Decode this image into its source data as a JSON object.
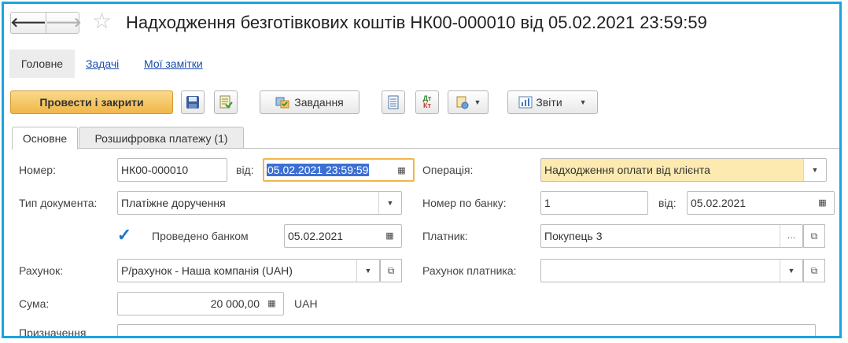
{
  "window": {
    "title": "Надходження безготівкових коштів НК00-000010 від 05.02.2021 23:59:59",
    "back_glyph": "🡐",
    "forward_glyph": "🡒",
    "favorite_glyph": "☆"
  },
  "panel_tabs": [
    {
      "label": "Головне"
    },
    {
      "label": "Задачі"
    },
    {
      "label": "Мої замітки"
    }
  ],
  "toolbar": {
    "post_and_close": "Провести і закрити",
    "tasks": "Завдання",
    "reports": "Звіти",
    "dtkt_top": "Дт",
    "dtkt_bottom": "Кт"
  },
  "form_tabs": [
    {
      "label": "Основне"
    },
    {
      "label": "Розшифровка платежу (1)"
    }
  ],
  "form": {
    "number_label": "Номер:",
    "number_value": "НК00-000010",
    "from_label": "від:",
    "date_value": "05.02.2021 23:59:59",
    "operation_label": "Операція:",
    "operation_value": "Надходження оплати від клієнта",
    "doc_type_label": "Тип документа:",
    "doc_type_value": "Платіжне доручення",
    "bank_number_label": "Номер по банку:",
    "bank_number_value": "1",
    "bank_date_label": "від:",
    "bank_date_value": "05.02.2021",
    "posted_by_bank_label": "Проведено банком",
    "posted_by_bank_checked": true,
    "posted_by_bank_date": "05.02.2021",
    "payer_label": "Платник:",
    "payer_value": "Покупець 3",
    "account_label": "Рахунок:",
    "account_value": "Р/рахунок - Наша компанія (UAH)",
    "payer_account_label": "Рахунок платника:",
    "payer_account_value": "",
    "amount_label": "Сума:",
    "amount_value": "20 000,00",
    "currency": "UAH",
    "purpose_label": "Призначення"
  },
  "colors": {
    "accent_border": "#1aa3e0",
    "primary_button": "#f0b64a",
    "operation_field": "#fdeab0",
    "link": "#1a4dad"
  }
}
